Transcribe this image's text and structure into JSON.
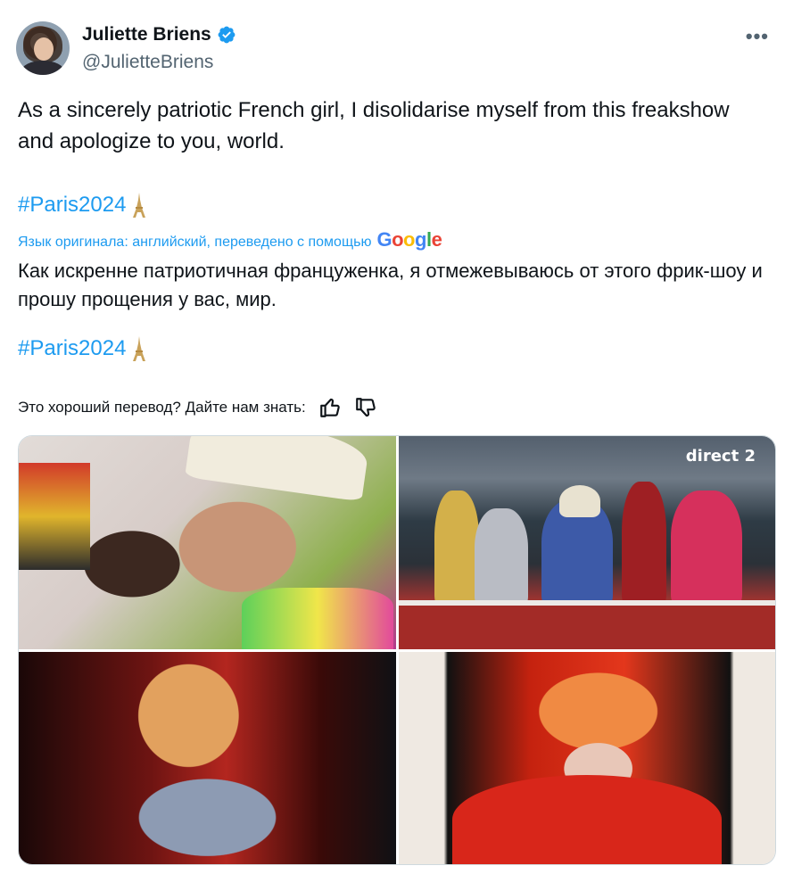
{
  "author": {
    "name": "Juliette Briens",
    "handle": "@JulietteBriens",
    "verified": true
  },
  "tweet": {
    "text": "As a sincerely patriotic French girl, I disolidarise myself from this freakshow and apologize to you, world.",
    "hashtag": "#Paris2024"
  },
  "translation": {
    "note": "Язык оригинала: английский, переведено с помощью",
    "provider": "Google",
    "text": "Как искренне патриотичная француженка, я отмежевываюсь от этого фрик-шоу и прошу прощения у вас, мир.",
    "hashtag": "#Paris2024"
  },
  "feedback": {
    "prompt": "Это хороший перевод? Дайте нам знать:"
  },
  "media": {
    "tile2_overlay": "direct 2"
  },
  "colors": {
    "link": "#1d9bf0",
    "verified": "#1d9bf0",
    "text": "#0f1419",
    "secondary": "#536471"
  },
  "icons": [
    "verified-badge-icon",
    "more-options-icon",
    "eiffel-tower-icon",
    "thumbs-up-icon",
    "thumbs-down-icon"
  ]
}
